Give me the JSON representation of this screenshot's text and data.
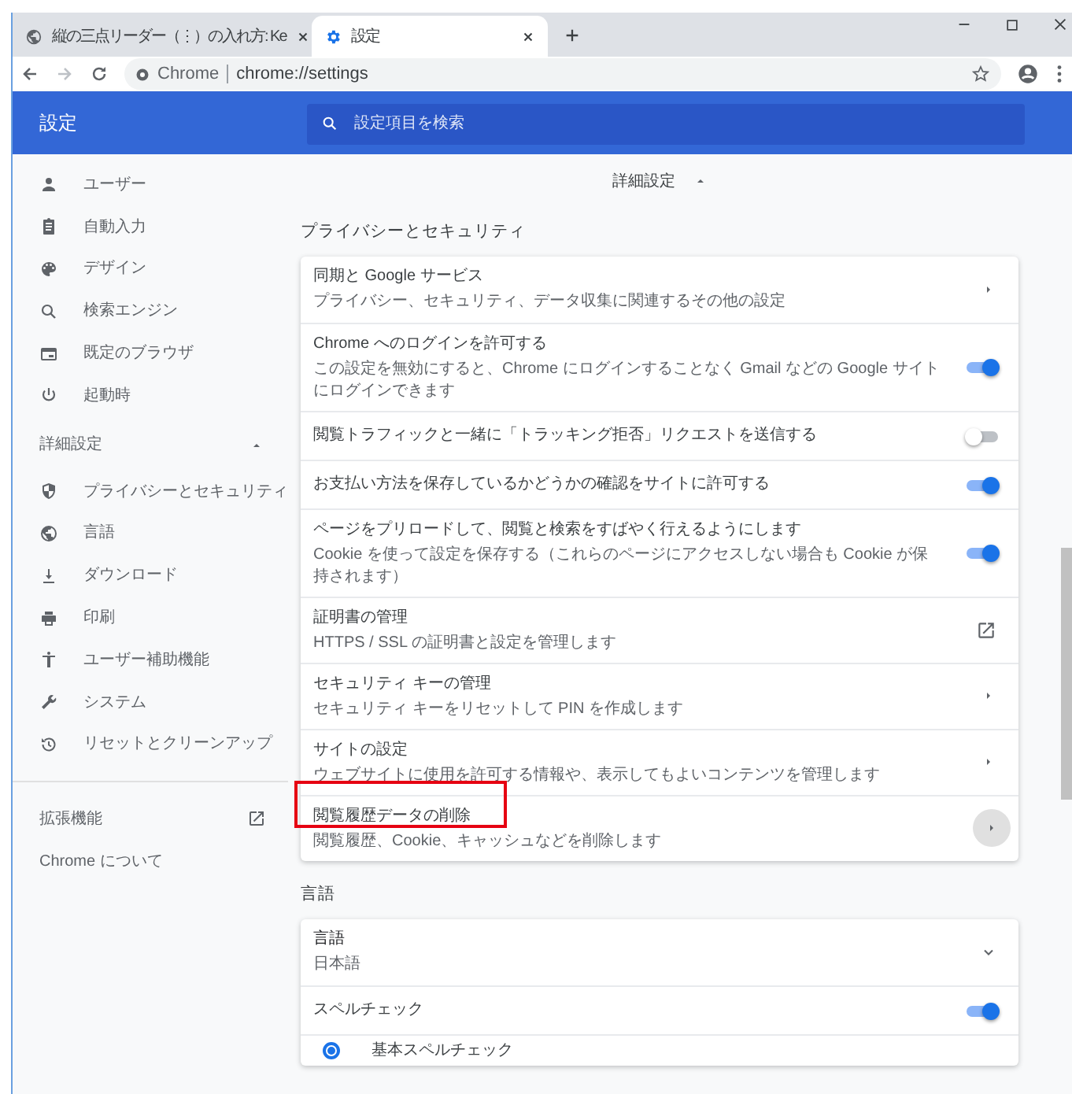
{
  "browser": {
    "tabs": [
      {
        "title": "縦の三点リーダー（⋮）の入れ方: Ke",
        "selected": false
      },
      {
        "title": "設定",
        "selected": true
      }
    ],
    "address": {
      "site": "Chrome",
      "url": "chrome://settings"
    }
  },
  "header": {
    "title": "設定",
    "search_placeholder": "設定項目を検索"
  },
  "sidebar": {
    "items": [
      {
        "label": "ユーザー"
      },
      {
        "label": "自動入力"
      },
      {
        "label": "デザイン"
      },
      {
        "label": "検索エンジン"
      },
      {
        "label": "既定のブラウザ"
      },
      {
        "label": "起動時"
      }
    ],
    "advanced": {
      "label": "詳細設定",
      "expanded": true,
      "items": [
        {
          "label": "プライバシーとセキュリティ"
        },
        {
          "label": "言語"
        },
        {
          "label": "ダウンロード"
        },
        {
          "label": "印刷"
        },
        {
          "label": "ユーザー補助機能"
        },
        {
          "label": "システム"
        },
        {
          "label": "リセットとクリーンアップ"
        }
      ]
    },
    "extensions": "拡張機能",
    "about": "Chrome について"
  },
  "main": {
    "advanced_toggle": {
      "label": "詳細設定",
      "expanded": true
    },
    "sections": [
      {
        "title": "プライバシーとセキュリティ",
        "rows": [
          {
            "kind": "link",
            "title": "同期と Google サービス",
            "subtitle": "プライバシー、セキュリティ、データ収集に関連するその他の設定"
          },
          {
            "kind": "toggle",
            "title": "Chrome へのログインを許可する",
            "subtitle": "この設定を無効にすると、Chrome にログインすることなく Gmail などの Google サイトにログインできます",
            "on": true
          },
          {
            "kind": "toggle",
            "title": "閲覧トラフィックと一緒に「トラッキング拒否」リクエストを送信する",
            "on": false
          },
          {
            "kind": "toggle",
            "title": "お支払い方法を保存しているかどうかの確認をサイトに許可する",
            "on": true
          },
          {
            "kind": "toggle",
            "title": "ページをプリロードして、閲覧と検索をすばやく行えるようにします",
            "subtitle": "Cookie を使って設定を保存する（これらのページにアクセスしない場合も Cookie が保持されます）",
            "on": true
          },
          {
            "kind": "external",
            "title": "証明書の管理",
            "subtitle": "HTTPS / SSL の証明書と設定を管理します"
          },
          {
            "kind": "link",
            "title": "セキュリティ キーの管理",
            "subtitle": "セキュリティ キーをリセットして PIN を作成します"
          },
          {
            "kind": "link",
            "title": "サイトの設定",
            "subtitle": "ウェブサイトに使用を許可する情報や、表示してもよいコンテンツを管理します"
          },
          {
            "kind": "link_hover",
            "title": "閲覧履歴データの削除",
            "subtitle": "閲覧履歴、Cookie、キャッシュなどを削除します",
            "highlight": true
          }
        ]
      },
      {
        "title": "言語",
        "rows": [
          {
            "kind": "dropdown",
            "title": "言語",
            "subtitle": "日本語",
            "expanded": false
          },
          {
            "kind": "toggle",
            "title": "スペルチェック",
            "on": true
          },
          {
            "kind": "radio",
            "title": "基本スペルチェック",
            "selected": true
          }
        ]
      }
    ]
  }
}
